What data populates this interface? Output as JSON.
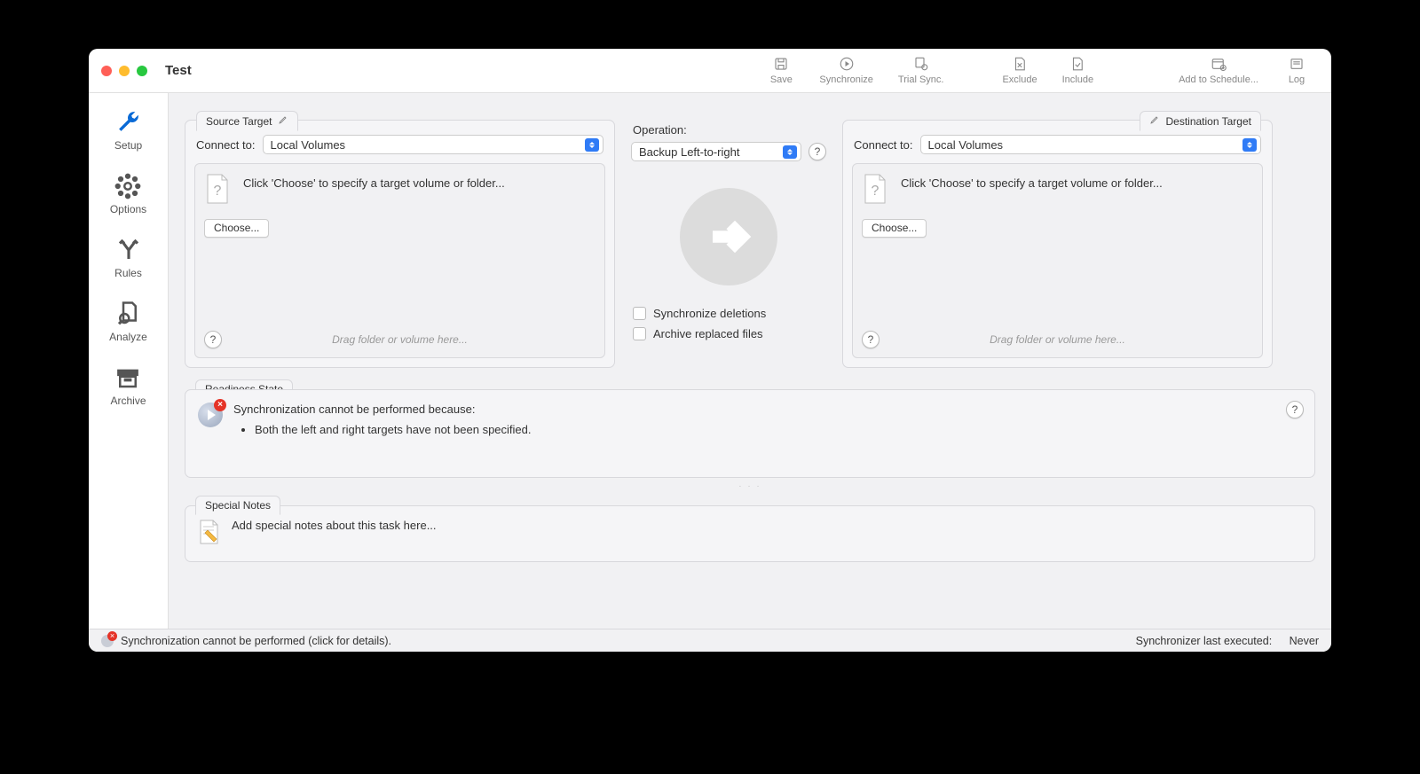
{
  "window": {
    "title": "Test"
  },
  "toolbar": {
    "save": "Save",
    "synchronize": "Synchronize",
    "trial_sync": "Trial Sync.",
    "exclude": "Exclude",
    "include": "Include",
    "add_schedule": "Add to Schedule...",
    "log": "Log"
  },
  "sidebar": {
    "setup": "Setup",
    "options": "Options",
    "rules": "Rules",
    "analyze": "Analyze",
    "archive": "Archive"
  },
  "source": {
    "tab": "Source Target",
    "connect_label": "Connect to:",
    "connect_value": "Local Volumes",
    "message": "Click 'Choose' to specify a target volume or folder...",
    "choose": "Choose...",
    "hint": "Drag folder or volume here..."
  },
  "destination": {
    "tab": "Destination Target",
    "connect_label": "Connect to:",
    "connect_value": "Local Volumes",
    "message": "Click 'Choose' to specify a target volume or folder...",
    "choose": "Choose...",
    "hint": "Drag folder or volume here..."
  },
  "operation": {
    "label": "Operation:",
    "value": "Backup Left-to-right",
    "sync_deletions": "Synchronize deletions",
    "archive_replaced": "Archive replaced files"
  },
  "readiness": {
    "tab": "Readiness State",
    "heading": "Synchronization cannot be performed because:",
    "bullet1": "Both the left and right targets have not been specified."
  },
  "notes": {
    "tab": "Special Notes",
    "placeholder": "Add special notes about this task here..."
  },
  "statusbar": {
    "message": "Synchronization cannot be performed (click for details).",
    "last_label": "Synchronizer last executed:",
    "last_value": "Never"
  }
}
